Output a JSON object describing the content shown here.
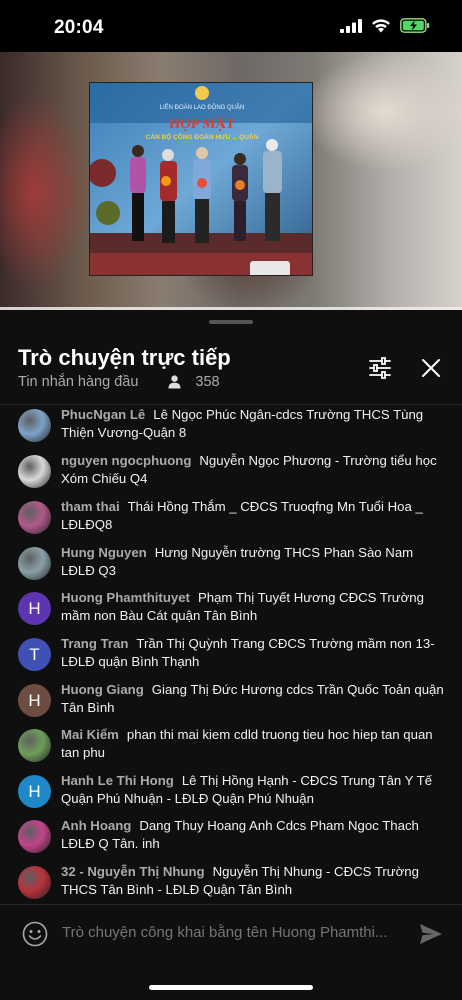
{
  "status_bar": {
    "time": "20:04"
  },
  "chat": {
    "title": "Trò chuyện trực tiếp",
    "subtitle": "Tin nhắn hàng đầu",
    "viewer_count": "358",
    "input_placeholder": "Trò chuyện công khai bằng tên Huong Phamthi..."
  },
  "messages": [
    {
      "author": "PhucNgan Lê",
      "text": "Lê Ngọc Phúc Ngân-cdcs Trường THCS Tùng Thiện Vương-Quận 8",
      "avatar": "photo",
      "avatar_color": "#7fa3c9"
    },
    {
      "author": "nguyen ngocphuong",
      "text": "Nguyễn Ngọc Phương - Trường tiểu học Xóm Chiếu Q4",
      "avatar": "photo",
      "avatar_color": "#d9d9d9"
    },
    {
      "author": "tham thai",
      "text": "Thái Hồng Thắm _ CĐCS Truoqfng Mn Tuổi Hoa _ LĐLĐQ8",
      "avatar": "photo",
      "avatar_color": "#b05a8a"
    },
    {
      "author": "Hung Nguyen",
      "text": "Hưng Nguyễn trường THCS Phan Sào Nam LĐLĐ Q3",
      "avatar": "photo",
      "avatar_color": "#8aa0a8"
    },
    {
      "author": "Huong Phamthituyet",
      "text": "Phạm Thị Tuyết Hương CĐCS Trường mầm non Bàu Cát quận Tân Bình",
      "avatar": "H",
      "avatar_color": "#5e35b1"
    },
    {
      "author": "Trang Tran",
      "text": "Trần Thị Quỳnh Trang CĐCS Trường mầm non 13-LĐLĐ quận Bình Thạnh",
      "avatar": "T",
      "avatar_color": "#3f51b5"
    },
    {
      "author": "Huong Giang",
      "text": "Giang Thị Đức Hương cdcs Trần Quốc Toản quận Tân Bình",
      "avatar": "H",
      "avatar_color": "#6d4c41"
    },
    {
      "author": "Mai Kiểm",
      "text": "phan thi mai kiem cdld truong tieu hoc hiep tan quan tan phu",
      "avatar": "photo",
      "avatar_color": "#6f9e5a"
    },
    {
      "author": "Hanh Le Thi Hong",
      "text": "Lê Thị Hồng Hạnh - CĐCS Trung Tân Y Tế Quận Phú Nhuận - LĐLĐ Quận Phú Nhuận",
      "avatar": "H",
      "avatar_color": "#1e88c8"
    },
    {
      "author": "Anh Hoang",
      "text": "Dang Thuy Hoang Anh Cdcs Pham Ngoc Thach LĐLĐ Q Tân. inh",
      "avatar": "photo",
      "avatar_color": "#c2448a"
    },
    {
      "author": "32 - Nguyễn Thị Nhung",
      "text": "Nguyễn Thị Nhung - CĐCS Trường THCS Tân Bình - LĐLĐ Quận Tân Bình",
      "avatar": "photo",
      "avatar_color": "#b8323c"
    }
  ],
  "video": {
    "banner_org": "LIÊN ĐOÀN LAO ĐỘNG QUẬN",
    "banner_title": "HỌP MẶT",
    "banner_sub": "CÁN BỘ CÔNG ĐOÀN HƯU ... QUẬN"
  }
}
